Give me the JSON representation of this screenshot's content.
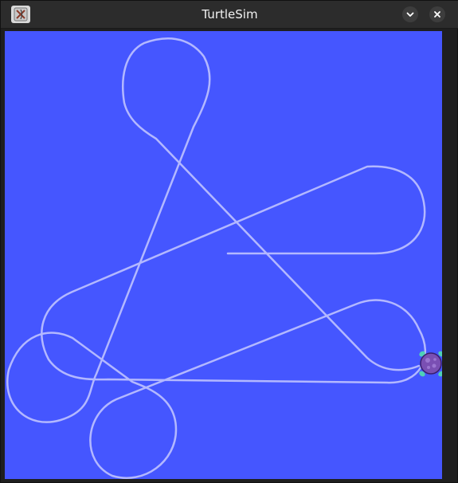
{
  "window": {
    "title": "TurtleSim",
    "background_color": "#4556ff",
    "pen_color": "#b3b8ff",
    "turtle_color": "#7a4fb3"
  },
  "titlebar": {
    "app_icon": "turtlesim-app-icon",
    "buttons": [
      {
        "name": "minimize",
        "icon": "chevron-down-icon"
      },
      {
        "name": "close",
        "icon": "close-icon"
      }
    ]
  }
}
